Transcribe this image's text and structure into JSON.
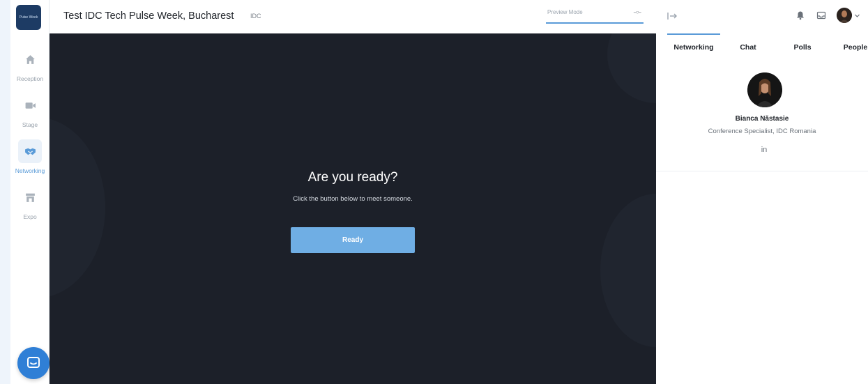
{
  "app": {
    "logo_text": "Pulse Week"
  },
  "nav": {
    "items": [
      {
        "label": "Reception",
        "icon": "home-icon"
      },
      {
        "label": "Stage",
        "icon": "video-icon"
      },
      {
        "label": "Networking",
        "icon": "handshake-icon"
      },
      {
        "label": "Expo",
        "icon": "store-icon"
      }
    ],
    "active": "Networking"
  },
  "header": {
    "title": "Test IDC Tech Pulse Week, Bucharest",
    "organizer": "IDC",
    "preview_label": "Preview Mode",
    "preview_toggle": "--○--"
  },
  "stage": {
    "heading": "Are you ready?",
    "subtext": "Click the button below to meet someone.",
    "button_label": "Ready"
  },
  "panel": {
    "tabs": [
      {
        "label": "Networking"
      },
      {
        "label": "Chat"
      },
      {
        "label": "Polls"
      },
      {
        "label": "People"
      }
    ],
    "active_tab": "Networking",
    "profile": {
      "name": "Bianca Năstasie",
      "role": "Conference Specialist, IDC Romania",
      "social": "in"
    }
  },
  "colors": {
    "accent": "#5a9bd8",
    "stage_bg": "#1c2029",
    "button": "#6faee4",
    "launcher": "#2f7fd6"
  }
}
